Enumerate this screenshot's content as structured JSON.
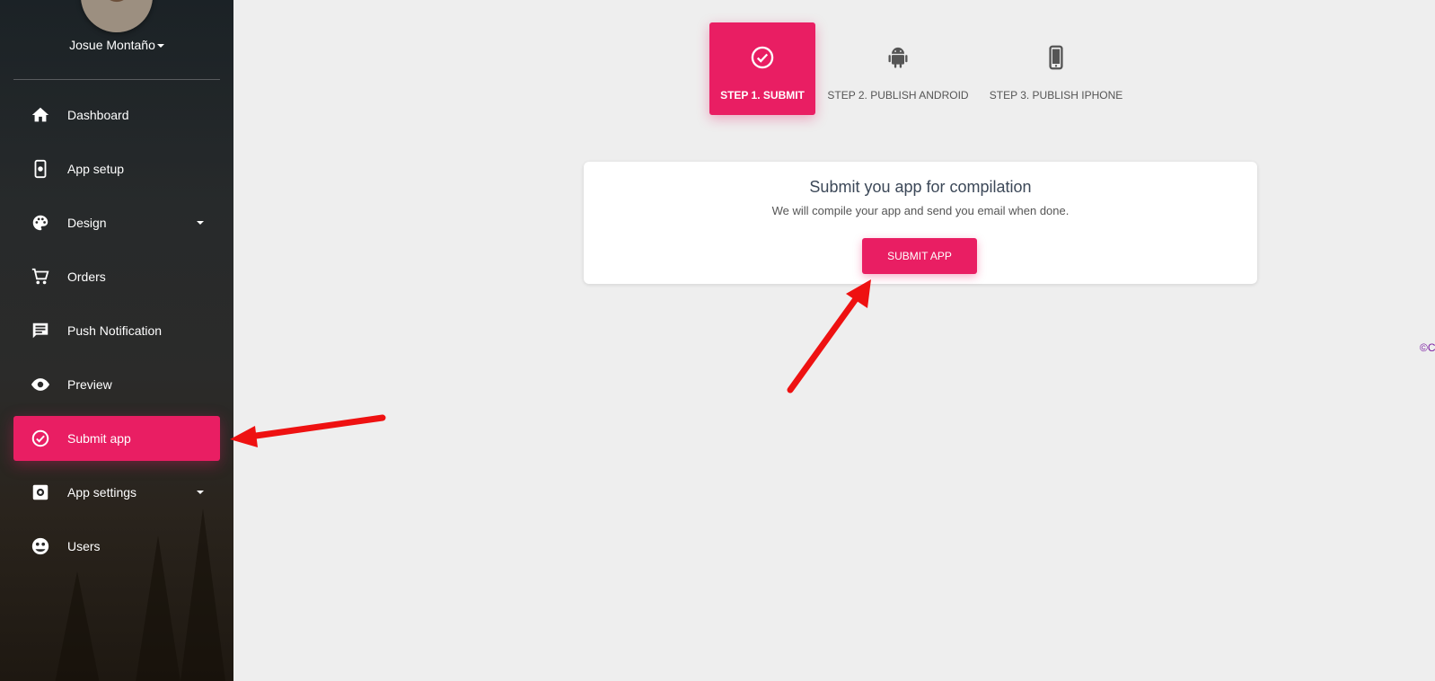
{
  "user": {
    "name": "Josue Montaño"
  },
  "sidebar": {
    "items": [
      {
        "label": "Dashboard",
        "icon": "home-icon"
      },
      {
        "label": "App setup",
        "icon": "phone-settings-icon"
      },
      {
        "label": "Design",
        "icon": "palette-icon",
        "has_dropdown": true
      },
      {
        "label": "Orders",
        "icon": "cart-icon"
      },
      {
        "label": "Push Notification",
        "icon": "notification-icon"
      },
      {
        "label": "Preview",
        "icon": "eye-icon"
      },
      {
        "label": "Submit app",
        "icon": "check-circle-icon",
        "active": true
      },
      {
        "label": "App settings",
        "icon": "settings-icon",
        "has_dropdown": true
      },
      {
        "label": "Users",
        "icon": "users-icon"
      }
    ]
  },
  "stepper": {
    "steps": [
      {
        "label": "STEP 1. SUBMIT",
        "icon": "check-circle-icon",
        "active": true
      },
      {
        "label": "STEP 2. PUBLISH ANDROID",
        "icon": "android-icon"
      },
      {
        "label": "STEP 3. PUBLISH IPHONE",
        "icon": "smartphone-icon"
      }
    ]
  },
  "card": {
    "title": "Submit you app for compilation",
    "description": "We will compile your app and send you email when done.",
    "button_label": "SUBMIT APP"
  },
  "footer": {
    "copyright": "©C"
  },
  "colors": {
    "accent": "#e91e63",
    "background": "#eeeeee",
    "annotation_arrow": "#ee1111"
  }
}
